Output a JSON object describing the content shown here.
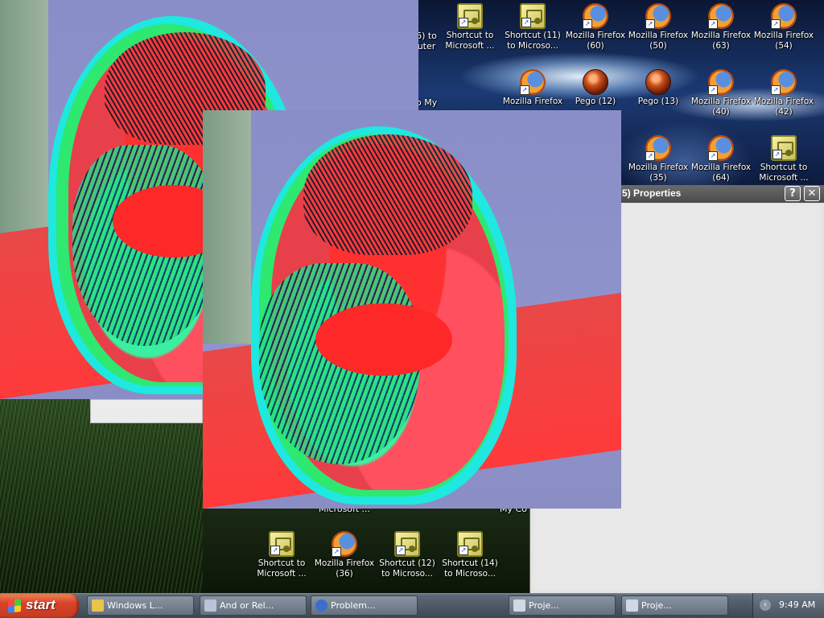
{
  "desktop": {
    "icons_top": [
      {
        "label": "Shortcut to Microsoft ...",
        "type": "shortcut"
      },
      {
        "label": "Shortcut (11) to Microso...",
        "type": "shortcut"
      },
      {
        "label": "Mozilla Firefox (60)",
        "type": "firefox"
      },
      {
        "label": "Mozilla Firefox (50)",
        "type": "firefox"
      },
      {
        "label": "Mozilla Firefox (63)",
        "type": "firefox"
      },
      {
        "label": "Mozilla Firefox (54)",
        "type": "firefox"
      }
    ],
    "icons_row2": [
      {
        "label": "Mozilla Firefox",
        "type": "firefox"
      },
      {
        "label": "Pego (12)",
        "type": "pego"
      },
      {
        "label": "Pego (13)",
        "type": "pego"
      },
      {
        "label": "Mozilla Firefox (40)",
        "type": "firefox"
      },
      {
        "label": "Mozilla Firefox (42)",
        "type": "firefox"
      }
    ],
    "icons_row3": [
      {
        "label": "Mozilla Firefox (35)",
        "type": "firefox"
      },
      {
        "label": "Mozilla Firefox (64)",
        "type": "firefox"
      },
      {
        "label": "Shortcut to Microsoft ...",
        "type": "shortcut"
      }
    ],
    "icons_bottom": [
      {
        "label": "Shortcut to Microsoft ...",
        "type": "shortcut"
      },
      {
        "label": "Mozilla Firefox (36)",
        "type": "firefox"
      },
      {
        "label": "Shortcut (12) to Microso...",
        "type": "shortcut"
      },
      {
        "label": "Shortcut (14) to Microso...",
        "type": "shortcut"
      }
    ],
    "partial_labels": {
      "left_col_1": "6) to",
      "left_col_2": "uter",
      "left_col_3": "to My",
      "behind_1": "Microsoft ...",
      "behind_2": "My Co"
    }
  },
  "properties_window": {
    "title": "5) Properties",
    "help_button": "?",
    "close_button": "✕"
  },
  "taskbar": {
    "start_label": "start",
    "tasks": [
      {
        "label": "Windows L..."
      },
      {
        "label": "And or Rel..."
      },
      {
        "label": "Problem..."
      },
      {
        "label": "Proje..."
      },
      {
        "label": "Proje..."
      }
    ],
    "tray_chevron": "‹",
    "clock": "9:49 AM"
  },
  "colors": {
    "taskbar": "#4e5966",
    "start": "#d9432a",
    "properties_title": "#5a5a5a",
    "image_red": "#ff3a3a",
    "image_cyan": "#1ee8e0",
    "image_green": "#2ee870"
  }
}
